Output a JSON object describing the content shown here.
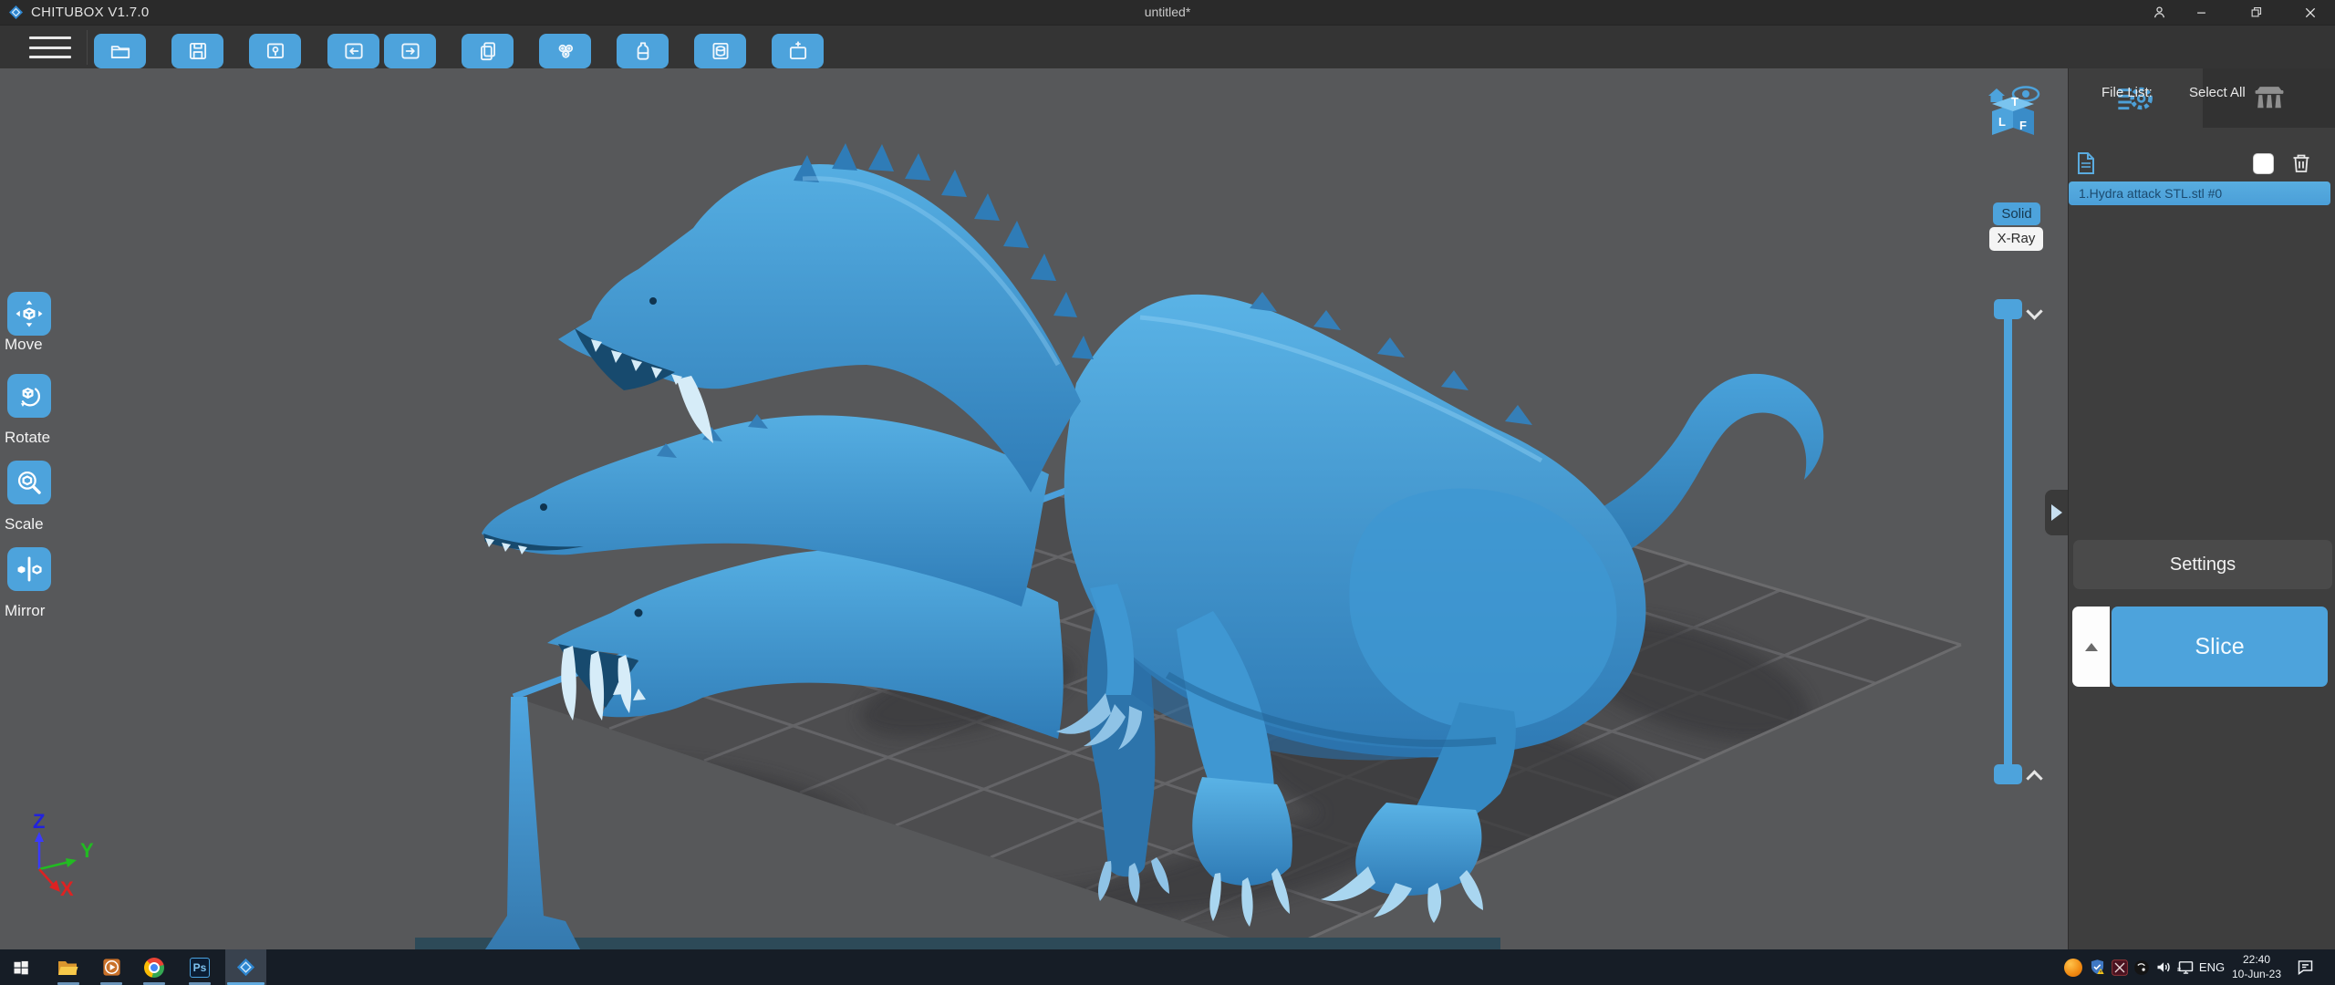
{
  "titlebar": {
    "app_title": "CHITUBOX V1.7.0",
    "document_title": "untitled*"
  },
  "toolbar": {
    "icons": [
      "open-file",
      "save",
      "screenshot",
      "undo",
      "redo",
      "clone",
      "hollow",
      "tank",
      "dig-hole",
      "merge"
    ]
  },
  "left_tools": [
    {
      "label": "Move",
      "icon": "move-icon"
    },
    {
      "label": "Rotate",
      "icon": "rotate-icon"
    },
    {
      "label": "Scale",
      "icon": "scale-icon"
    },
    {
      "label": "Mirror",
      "icon": "mirror-icon"
    }
  ],
  "viewport": {
    "render_modes": [
      {
        "label": "Solid",
        "active": true
      },
      {
        "label": "X-Ray",
        "active": false
      }
    ],
    "view_cube_faces": {
      "top": "T",
      "left": "L",
      "front": "F"
    },
    "axis_labels": {
      "x": "X",
      "y": "Y",
      "z": "Z"
    },
    "model_name": "Hydra attack STL"
  },
  "right_panel": {
    "tabs": [
      {
        "icon": "slice-settings-icon",
        "active": true
      },
      {
        "icon": "support-icon",
        "active": false
      }
    ],
    "file_list_label": "File List:",
    "select_all_label": "Select All",
    "select_all_checked": false,
    "files": [
      {
        "label": "1.Hydra attack STL.stl #0",
        "selected": true
      }
    ],
    "settings_button": "Settings",
    "slice_button": "Slice"
  },
  "taskbar": {
    "pinned_icons": [
      "windows-start",
      "file-explorer",
      "media-player",
      "chrome",
      "photoshop",
      "chitubox"
    ],
    "photoshop_glyph": "Ps",
    "tray": {
      "icons": [
        "avast",
        "security-shield",
        "red-app",
        "audio-device",
        "speaker",
        "network",
        "action-center"
      ],
      "language": "ENG",
      "time": "22:40",
      "date": "10-Jun-23"
    }
  },
  "colors": {
    "accent_blue": "#4da3dc",
    "model_blue": "#3f9ddd",
    "panel_bg": "#3e3e3e",
    "toolbar_bg": "#343434",
    "titlebar_bg": "#2a2a2a",
    "viewport_bg": "#57585a",
    "taskbar_bg": "#161d26",
    "selected_file_text": "#1c4a6e",
    "build_plate_edge": "#4aa0dc"
  }
}
